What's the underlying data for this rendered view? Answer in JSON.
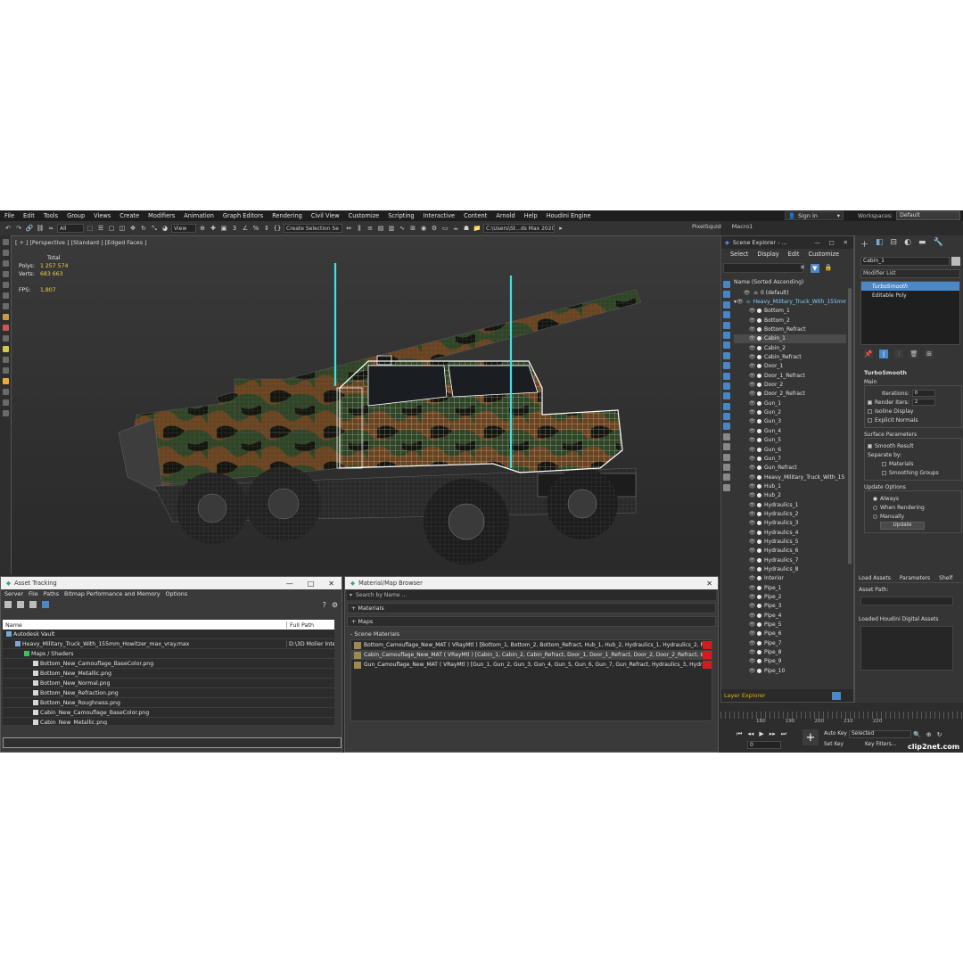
{
  "menu": [
    "File",
    "Edit",
    "Tools",
    "Group",
    "Views",
    "Create",
    "Modifiers",
    "Animation",
    "Graph Editors",
    "Rendering",
    "Civil View",
    "Customize",
    "Scripting",
    "Interactive",
    "Content",
    "Arnold",
    "Help",
    "Houdini Engine"
  ],
  "signin": "Sign In",
  "workspaces_label": "Workspaces:",
  "workspace_value": "Default",
  "toolbar": {
    "filter": "All",
    "ref_coord": "View",
    "selection_set": "Create Selection Se",
    "path": "C:\\Users\\St...ds Max 2020",
    "pixelsquid": "PixelSquid",
    "macro": "Macro1"
  },
  "viewport": {
    "label": "[ + ] [Perspective ] [Standard ] [Edged Faces ]",
    "stats_header": "Total",
    "polys_label": "Polys:",
    "polys_value": "1 257 574",
    "verts_label": "Verts:",
    "verts_value": "683 663",
    "fps_label": "FPS:",
    "fps_value": "1,807"
  },
  "scene_explorer": {
    "title": "Scene Explorer - ...",
    "menu": [
      "Select",
      "Display",
      "Edit",
      "Customize"
    ],
    "column_header": "Name (Sorted Ascending)",
    "items": [
      {
        "name": "0 (default)",
        "level": 0,
        "root": false
      },
      {
        "name": "Heavy_Military_Truck_With_155mm",
        "level": 0,
        "root": true
      },
      {
        "name": "Bottom_1",
        "level": 1
      },
      {
        "name": "Bottom_2",
        "level": 1
      },
      {
        "name": "Bottom_Refract",
        "level": 1
      },
      {
        "name": "Cabin_1",
        "level": 1,
        "selected": true
      },
      {
        "name": "Cabin_2",
        "level": 1
      },
      {
        "name": "Cabin_Refract",
        "level": 1
      },
      {
        "name": "Door_1",
        "level": 1
      },
      {
        "name": "Door_1_Refract",
        "level": 1
      },
      {
        "name": "Door_2",
        "level": 1
      },
      {
        "name": "Door_2_Refract",
        "level": 1
      },
      {
        "name": "Gun_1",
        "level": 1
      },
      {
        "name": "Gun_2",
        "level": 1
      },
      {
        "name": "Gun_3",
        "level": 1
      },
      {
        "name": "Gun_4",
        "level": 1
      },
      {
        "name": "Gun_5",
        "level": 1
      },
      {
        "name": "Gun_6",
        "level": 1
      },
      {
        "name": "Gun_7",
        "level": 1
      },
      {
        "name": "Gun_Refract",
        "level": 1
      },
      {
        "name": "Heavy_Military_Truck_With_15",
        "level": 1
      },
      {
        "name": "Hub_1",
        "level": 1
      },
      {
        "name": "Hub_2",
        "level": 1
      },
      {
        "name": "Hydraulics_1",
        "level": 1
      },
      {
        "name": "Hydraulics_2",
        "level": 1
      },
      {
        "name": "Hydraulics_3",
        "level": 1
      },
      {
        "name": "Hydraulics_4",
        "level": 1
      },
      {
        "name": "Hydraulics_5",
        "level": 1
      },
      {
        "name": "Hydraulics_6",
        "level": 1
      },
      {
        "name": "Hydraulics_7",
        "level": 1
      },
      {
        "name": "Hydraulics_8",
        "level": 1
      },
      {
        "name": "Interior",
        "level": 1
      },
      {
        "name": "Pipe_1",
        "level": 1
      },
      {
        "name": "Pipe_2",
        "level": 1
      },
      {
        "name": "Pipe_3",
        "level": 1
      },
      {
        "name": "Pipe_4",
        "level": 1
      },
      {
        "name": "Pipe_5",
        "level": 1
      },
      {
        "name": "Pipe_6",
        "level": 1
      },
      {
        "name": "Pipe_7",
        "level": 1
      },
      {
        "name": "Pipe_8",
        "level": 1
      },
      {
        "name": "Pipe_9",
        "level": 1
      },
      {
        "name": "Pipe_10",
        "level": 1
      }
    ],
    "layer_explorer": "Layer Explorer"
  },
  "command_panel": {
    "object_name": "Cabin_1",
    "modifier_list": "Modifier List",
    "stack": [
      "TurboSmooth",
      "Editable Poly"
    ],
    "rollout_title": "TurboSmooth",
    "main_label": "Main",
    "iterations_label": "Iterations:",
    "iterations_value": "0",
    "render_iters_label": "Render Iters:",
    "render_iters_value": "2",
    "isoline": "Isoline Display",
    "explicit_normals": "Explicit Normals",
    "surface_params": "Surface Parameters",
    "smooth_result": "Smooth Result",
    "separate_by": "Separate by:",
    "materials": "Materials",
    "smoothing_groups": "Smoothing Groups",
    "update_options": "Update Options",
    "always": "Always",
    "when_rendering": "When Rendering",
    "manually": "Manually",
    "update_button": "Update",
    "houdini_tabs": [
      "Load Assets",
      "Parameters",
      "Shelf"
    ],
    "asset_path": "Asset Path:",
    "loaded_assets": "Loaded Houdini Digital Assets"
  },
  "asset_tracking": {
    "title": "Asset Tracking",
    "menu": [
      "Server",
      "File",
      "Paths",
      "Bitmap Performance and Memory",
      "Options"
    ],
    "col_name": "Name",
    "col_path": "Full Path",
    "rows": [
      {
        "name": "Autodesk Vault",
        "path": "",
        "indent": 0,
        "icon": "b"
      },
      {
        "name": "Heavy_Military_Truck_With_155mm_Howitzer_max_vray.max",
        "path": "D:\\3D Molier Inte",
        "indent": 1,
        "icon": "b"
      },
      {
        "name": "Maps / Shaders",
        "path": "",
        "indent": 2,
        "icon": "g"
      },
      {
        "name": "Bottom_New_Camouflage_BaseColor.png",
        "path": "",
        "indent": 3,
        "icon": "w"
      },
      {
        "name": "Bottom_New_Metallic.png",
        "path": "",
        "indent": 3,
        "icon": "w"
      },
      {
        "name": "Bottom_New_Normal.png",
        "path": "",
        "indent": 3,
        "icon": "w"
      },
      {
        "name": "Bottom_New_Refraction.png",
        "path": "",
        "indent": 3,
        "icon": "w"
      },
      {
        "name": "Bottom_New_Roughness.png",
        "path": "",
        "indent": 3,
        "icon": "w"
      },
      {
        "name": "Cabin_New_Camouflage_BaseColor.png",
        "path": "",
        "indent": 3,
        "icon": "w"
      },
      {
        "name": "Cabin_New_Metallic.png",
        "path": "",
        "indent": 3,
        "icon": "w"
      }
    ]
  },
  "material_browser": {
    "title": "Material/Map Browser",
    "search_placeholder": "Search by Name ...",
    "materials_section": "+ Materials",
    "maps_section": "+ Maps",
    "scene_materials": "- Scene Materials",
    "rows": [
      "Bottom_Camouflage_New_MAT  ( VRayMtl ) [Bottom_1, Bottom_2, Bottom_Refract, Hub_1, Hub_2, Hydraulics_1, Hydraulics_2, Platfo...",
      "Cabin_Camouflage_New_MAT  ( VRayMtl ) [Cabin_1, Cabin_2, Cabin_Refract, Door_1, Door_1_Refract, Door_2, Door_2_Refract, Interi...",
      "Gun_Camouflage_New_MAT  ( VRayMtl ) [Gun_1, Gun_2, Gun_3, Gun_4, Gun_5, Gun_6, Gun_7, Gun_Refract, Hydraulics_3, Hydraulic..."
    ]
  },
  "timeline": {
    "ticks": [
      "180",
      "190",
      "200",
      "210",
      "220"
    ],
    "frame": "0",
    "auto_key": "Auto Key",
    "set_key": "Set Key",
    "selected": "Selected",
    "key_filters": "Key Filters..."
  },
  "watermark": "clip2net.com"
}
